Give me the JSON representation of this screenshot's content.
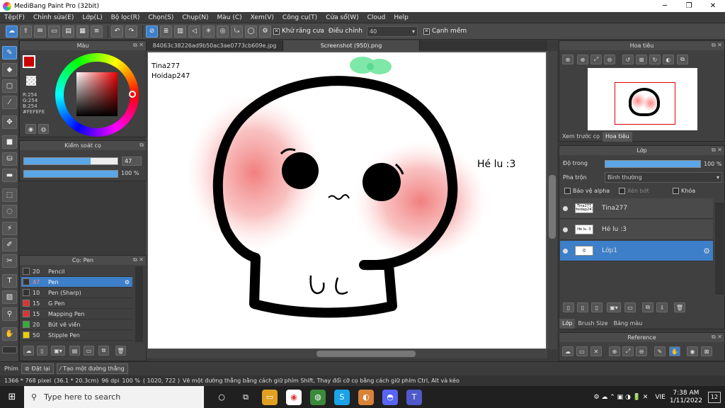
{
  "window": {
    "title": "MediBang Paint Pro (32bit)"
  },
  "menu": [
    "Tệp(F)",
    "Chỉnh sửa(E)",
    "Lớp(L)",
    "Bộ lọc(R)",
    "Chọn(S)",
    "Chụp(N)",
    "Màu (C)",
    "Xem(V)",
    "Công cụ(T)",
    "Cửa sổ(W)",
    "Cloud",
    "Help"
  ],
  "toolbar": {
    "antialias": "Khử răng cưa",
    "adjust": "Điều chỉnh",
    "adjust_value": "40",
    "snap": "Cạnh mềm"
  },
  "color_panel": {
    "title": "Màu",
    "rgb": {
      "r": "R:254",
      "g": "G:254",
      "b": "B:254"
    },
    "hex": "#FEFEFE"
  },
  "brush_control": {
    "title": "Kiểm soát cọ",
    "size": "47",
    "opacity": "100 %",
    "size_fraction": 0.71,
    "opacity_fraction": 1.0
  },
  "brush_panel": {
    "title": "Cọ: Pen",
    "items": [
      {
        "size": "20",
        "name": "Pencil",
        "color": "#333333",
        "selected": false
      },
      {
        "size": "47",
        "name": "Pen",
        "color": "#333333",
        "selected": true
      },
      {
        "size": "10",
        "name": "Pen (Sharp)",
        "color": "#333333",
        "selected": false
      },
      {
        "size": "15",
        "name": "G Pen",
        "color": "#e03030",
        "selected": false
      },
      {
        "size": "15",
        "name": "Mapping Pen",
        "color": "#e03030",
        "selected": false
      },
      {
        "size": "20",
        "name": "Bút vẽ viền",
        "color": "#30b030",
        "selected": false
      },
      {
        "size": "50",
        "name": "Stipple Pen",
        "color": "#e8d000",
        "selected": false
      }
    ]
  },
  "tabs": [
    {
      "label": "84063c38226ad9b50ac3ae0773cb609e.jpg",
      "active": false
    },
    {
      "label": "Screenshot (950).png",
      "active": true
    }
  ],
  "canvas": {
    "text1": "Tina277",
    "text2": "Hoidap247",
    "text3": "Hé lu :3"
  },
  "navigator": {
    "title": "Hoa tiêu",
    "tabs": [
      "Xem trước cọ",
      "Hoa tiêu"
    ]
  },
  "layers": {
    "title": "Lớp",
    "opacity_label": "Độ trong",
    "opacity": "100 %",
    "blend_label": "Pha trộn",
    "blend": "Bình thường",
    "protect_alpha": "Bảo vệ alpha",
    "clip": "Xén bớt",
    "lock": "Khóa",
    "items": [
      {
        "name": "Tina277",
        "thumb": "Tina277 Hoidap247",
        "selected": false
      },
      {
        "name": "Hé lu :3",
        "thumb": "Hé lu :3",
        "selected": false
      },
      {
        "name": "Lớp1",
        "thumb": "☺",
        "selected": true
      }
    ],
    "bottom_tabs": [
      "Lớp",
      "Brush Size",
      "Bảng màu"
    ]
  },
  "reference": {
    "title": "Reference"
  },
  "statusbar": {
    "phim": "Phím",
    "reset": "Đặt lại",
    "straight": "Tạo một đường thẳng"
  },
  "info": {
    "size": "1366 * 768 pixel",
    "cm": "(36.1 * 20.3cm)",
    "dpi": "96 dpi",
    "zoom": "100 %",
    "coords": "( 1020, 722 )",
    "hint": "Vẽ một đường thẳng bằng cách giữ phím Shift, Thay đổi cỡ cọ bằng cách giữ phím Ctrl, Alt và kéo"
  },
  "taskbar": {
    "search": "Type here to search",
    "lang": "VIE",
    "time": "7:38 AM",
    "date": "1/11/2022",
    "notif": "12"
  }
}
